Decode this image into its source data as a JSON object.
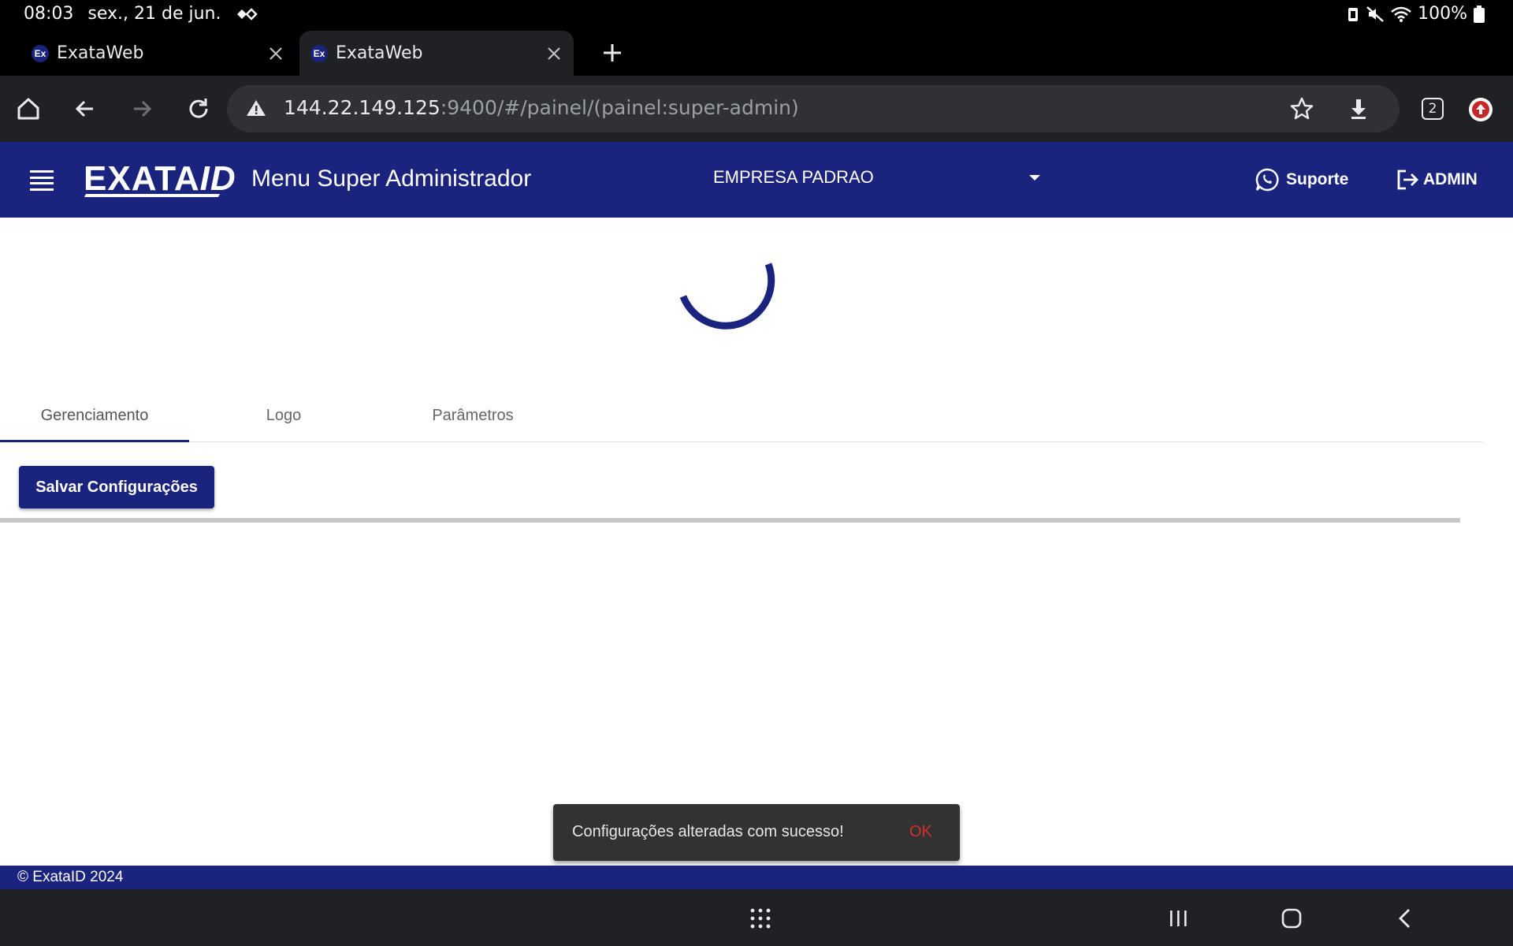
{
  "status_bar": {
    "time": "08:03",
    "date": "sex., 21 de jun.",
    "battery": "100%"
  },
  "browser": {
    "tabs": [
      {
        "title": "ExataWeb",
        "favicon": "Ex"
      },
      {
        "title": "ExataWeb",
        "favicon": "Ex"
      }
    ],
    "url_host": "144.22.149.125",
    "url_rest": ":9400/#/painel/(painel:super-admin)",
    "tab_count": "2"
  },
  "app_header": {
    "logo_main": "EXATA",
    "logo_suffix": "ID",
    "title": "Menu Super Administrador",
    "company": "EMPRESA PADRAO",
    "support_label": "Suporte",
    "user_label": "ADMIN"
  },
  "tabs": [
    {
      "label": "Gerenciamento",
      "active": true
    },
    {
      "label": "Logo",
      "active": false
    },
    {
      "label": "Parâmetros",
      "active": false
    }
  ],
  "save_button": "Salvar Configurações",
  "snackbar": {
    "message": "Configurações alteradas com sucesso!",
    "action": "OK"
  },
  "footer": "© ExataID 2024",
  "colors": {
    "brand": "#1a237e",
    "snackbar_action": "#d32f2f"
  }
}
